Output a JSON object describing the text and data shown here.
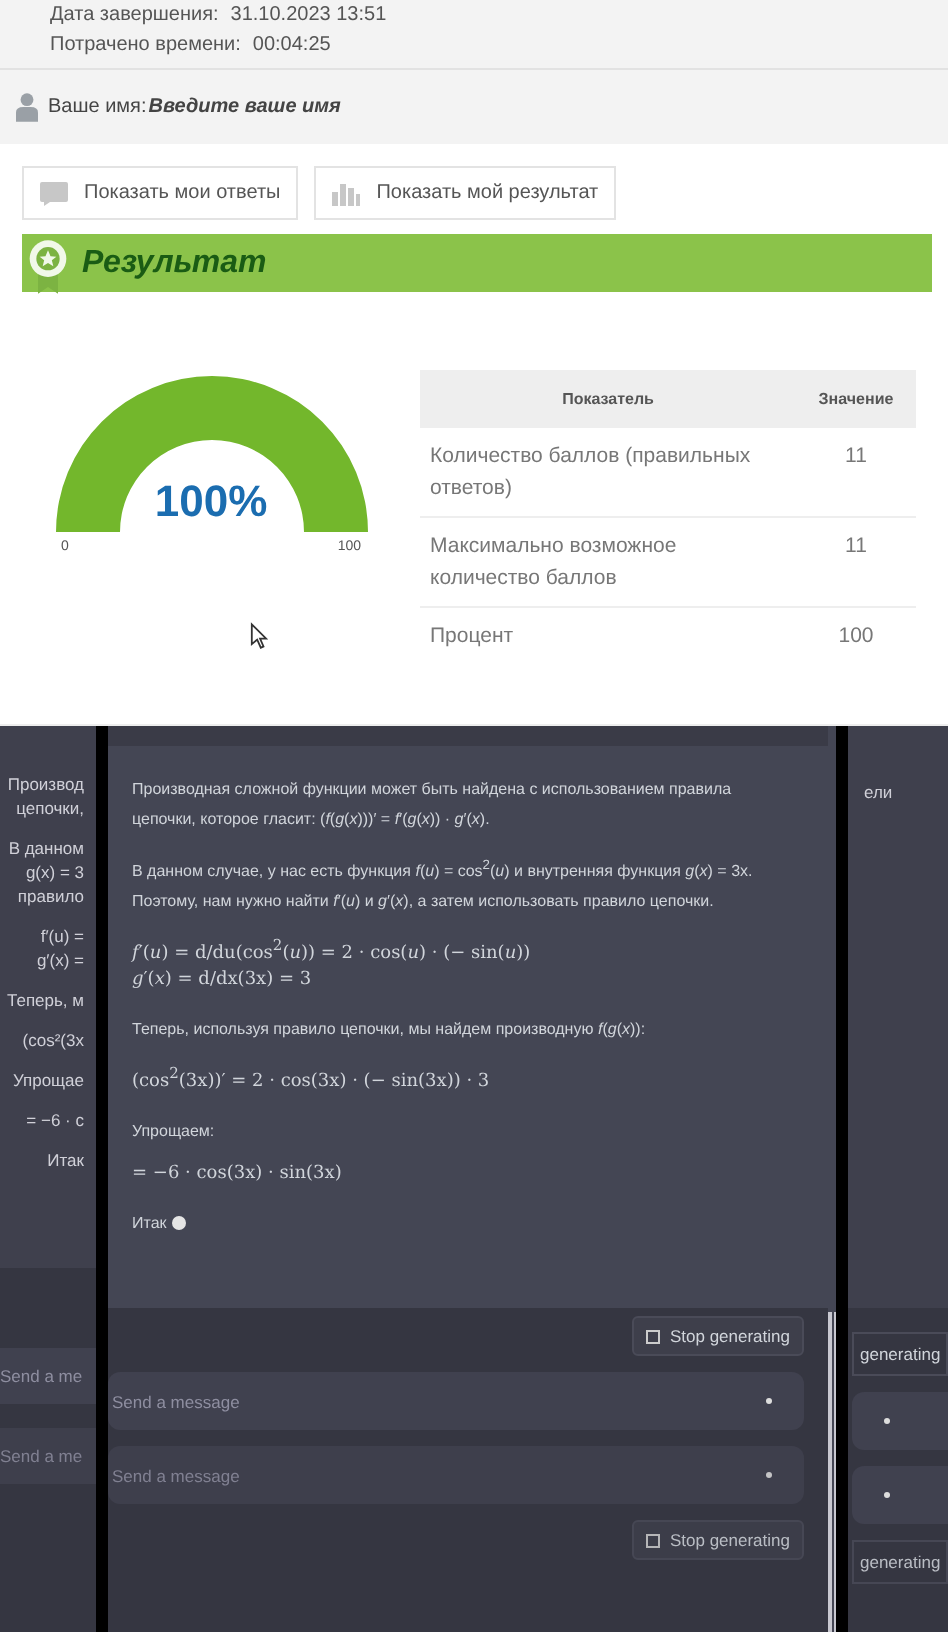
{
  "result_page": {
    "info": [
      {
        "label": "Дата завершения:",
        "value": "31.10.2023 13:51"
      },
      {
        "label": "Потрачено времени:",
        "value": "00:04:25"
      }
    ],
    "name": {
      "label": "Ваше имя:",
      "value": "Введите ваше имя"
    },
    "buttons": [
      {
        "kind": "answers",
        "label": "Показать мои ответы"
      },
      {
        "kind": "result",
        "label": "Показать мой результат"
      }
    ],
    "section_title": "Результат",
    "gauge": {
      "reading": "100%",
      "min_label": "0",
      "max_label": "100"
    },
    "table": {
      "columns": [
        "Показатель",
        "Значение"
      ],
      "rows": [
        [
          "Количество баллов (правильных ответов)",
          "11"
        ],
        [
          "Максимально возможное количество баллов",
          "11"
        ],
        [
          "Процент",
          "100"
        ]
      ]
    }
  },
  "chat": {
    "left_fragments": [
      [
        "Производ",
        "цепочки,"
      ],
      [
        "В данном",
        "g(x) = 3",
        "правило"
      ],
      [
        "f′(u) =",
        "g′(x) ="
      ],
      [
        "Теперь, м"
      ],
      [
        "(cos²(3x"
      ],
      [
        "Упрощае"
      ],
      [
        "= −6 · c"
      ],
      [
        "Итак"
      ]
    ],
    "message": [
      {
        "kind": "text",
        "text": "Производная сложной функции может быть найдена с использованием правила цепочки, которое гласит: (*f*(*g*(*x*)))′ = *f*′(*g*(*x*)) · *g*′(*x*)."
      },
      {
        "kind": "text",
        "text": "В данном случае, у нас есть функция *f*(*u*) = cos$^{2}$(*u*) и внутренняя функция *g*(*x*) = 3x. Поэтому, нам нужно найти *f*′(*u*) и *g*′(*x*), а затем использовать правило цепочки."
      },
      {
        "kind": "formula",
        "lines": [
          "*f*′(*u*) = d/du(cos$^{2}$(*u*)) = 2 · cos(*u*) · (− sin(*u*))",
          "*g*′(*x*) = d/dx(3x) = 3"
        ]
      },
      {
        "kind": "text",
        "text": "Теперь, используя правило цепочки, мы найдем производную *f*(*g*(*x*)):"
      },
      {
        "kind": "formula",
        "lines": [
          "(cos$^{2}$(3x))′ = 2 · cos(3x) · (− sin(3x)) · 3"
        ]
      },
      {
        "kind": "text",
        "text": "Упрощаем:"
      },
      {
        "kind": "formula",
        "lines": [
          "= −6 · cos(3x) · sin(3x)"
        ]
      },
      {
        "kind": "typing",
        "text": "Итак"
      }
    ],
    "stop_button": "Stop generating",
    "input_placeholder": "Send a message",
    "flipped_input_placeholder": "Send a message",
    "flipped_stop_button": "Stop generating",
    "left_input_fragment": "Send a me",
    "left_flipped_input_fragment": "Send a me",
    "right_fragments": {
      "top": "ели",
      "stop": "generating",
      "flipped_stop": "generating"
    }
  }
}
